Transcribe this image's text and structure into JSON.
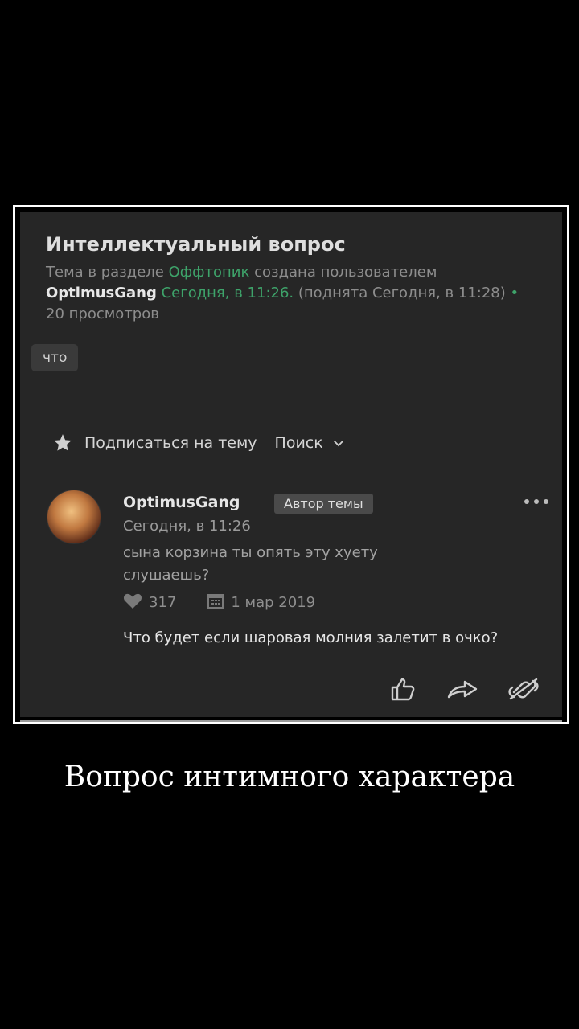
{
  "thread": {
    "title": "Интеллектуальный вопрос",
    "meta_prefix": "Тема в разделе ",
    "section": "Оффтопик",
    "meta_mid": " создана пользователем",
    "author": "OptimusGang",
    "created": "Сегодня, в 11:26.",
    "raised": " (поднята Сегодня, в 11:28) ",
    "dot": "•",
    "views": "20 просмотров",
    "tag": "что"
  },
  "actions": {
    "subscribe_label": "Подписаться на тему",
    "search_label": "Поиск"
  },
  "post": {
    "author": "OptimusGang",
    "badge": "Автор темы",
    "time": "Сегодня, в 11:26",
    "quote": "сына корзина ты опять эту хуету слушаешь?",
    "likes": "317",
    "date": "1 мар 2019",
    "body": "Что будет если шаровая молния залетит в очко?"
  },
  "icons": [
    "star-icon",
    "chevron-down-icon",
    "more-icon",
    "heart-icon",
    "calendar-icon",
    "thumbs-up-icon",
    "share-icon",
    "unlink-icon"
  ],
  "colors": {
    "accent_green": "#3ea36a",
    "panel": "#262626"
  },
  "caption": "Вопрос интимного характера"
}
